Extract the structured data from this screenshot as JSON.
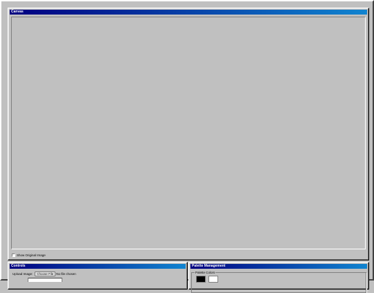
{
  "canvas": {
    "title": "Canvas",
    "show_original_label": "Show Original Image",
    "show_original_checked": false
  },
  "controls": {
    "title": "Controls",
    "upload_label": "Upload Image:",
    "choose_file_label": "Choose File",
    "no_file_label": "No file chosen"
  },
  "palette": {
    "title": "Palette Management",
    "colors_legend": "Palette Colors",
    "swatches": [
      {
        "color": "#000000",
        "name": "black-swatch"
      },
      {
        "color": "#ffffff",
        "name": "white-swatch"
      }
    ]
  },
  "colors": {
    "titlebar_start": "#000080",
    "titlebar_end": "#1084d0",
    "face": "#c0c0c0"
  }
}
